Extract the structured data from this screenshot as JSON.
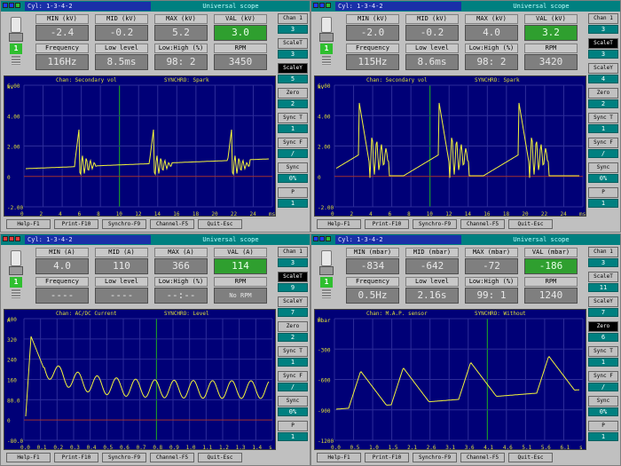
{
  "panels": [
    {
      "lamps": [
        "#1f3cff",
        "#1f3cff",
        "#2fbf2f"
      ],
      "cyl": "Cyl: 1-3-4-2",
      "name": "Universal scope",
      "plug": "1",
      "readings": [
        {
          "label": "MIN (kV)",
          "value": "-2.4",
          "green": false
        },
        {
          "label": "MID (kV)",
          "value": "-0.2",
          "green": false
        },
        {
          "label": "MAX (kV)",
          "value": "5.2",
          "green": false
        },
        {
          "label": "VAL (kV)",
          "value": "3.0",
          "green": true
        },
        {
          "label": "Frequency",
          "value": "116Hz",
          "green": false
        },
        {
          "label": "Low level",
          "value": "8.5ms",
          "green": false
        },
        {
          "label": "Low:High (%)",
          "value": "98: 2",
          "green": false
        },
        {
          "label": "RPM",
          "value": "3450",
          "green": false
        }
      ],
      "plot_left": "Chan: Secondary vol",
      "plot_right": "SYNCHRO: Spark",
      "unit": "kV",
      "y_ticks": [
        "6.00",
        "4.00",
        "2.00",
        "0",
        "-2.00"
      ],
      "x_ticks": [
        "0",
        "2",
        "4",
        "6",
        "8",
        "10",
        "12",
        "14",
        "16",
        "18",
        "20",
        "22",
        "24",
        "ms"
      ],
      "side": [
        {
          "btn": "Chan 1",
          "dark": false,
          "val": "3"
        },
        {
          "btn": "ScaleT",
          "dark": false,
          "val": "3"
        },
        {
          "btn": "ScaleY",
          "dark": true,
          "val": "5"
        },
        {
          "btn": "Zero",
          "dark": false,
          "val": "2"
        },
        {
          "btn": "Sync T",
          "dark": false,
          "val": "1"
        },
        {
          "btn": "Sync F",
          "dark": false,
          "val": "/"
        },
        {
          "btn": "Sync",
          "dark": false,
          "val": "0%"
        },
        {
          "btn": "P",
          "dark": false,
          "val": "1"
        }
      ],
      "fkeys": [
        "Help-F1",
        "Print-F10",
        "Synchro-F9",
        "Channel-F5",
        "Quit-Esc"
      ]
    },
    {
      "lamps": [
        "#1f3cff",
        "#1f3cff",
        "#2fbf2f"
      ],
      "cyl": "Cyl: 1-3-4-2",
      "name": "Universal scope",
      "plug": "1",
      "readings": [
        {
          "label": "MIN (kV)",
          "value": "-2.0",
          "green": false
        },
        {
          "label": "MID (kV)",
          "value": "-0.2",
          "green": false
        },
        {
          "label": "MAX (kV)",
          "value": "4.0",
          "green": false
        },
        {
          "label": "VAL (kV)",
          "value": "3.2",
          "green": true
        },
        {
          "label": "Frequency",
          "value": "115Hz",
          "green": false
        },
        {
          "label": "Low level",
          "value": "8.6ms",
          "green": false
        },
        {
          "label": "Low:High (%)",
          "value": "98: 2",
          "green": false
        },
        {
          "label": "RPM",
          "value": "3420",
          "green": false
        }
      ],
      "plot_left": "Chan: Secondary vol",
      "plot_right": "SYNCHRO: Spark",
      "unit": "kV",
      "y_ticks": [
        "6.00",
        "4.00",
        "2.00",
        "0",
        "-2.00"
      ],
      "x_ticks": [
        "0",
        "2",
        "4",
        "6",
        "8",
        "10",
        "12",
        "14",
        "16",
        "18",
        "20",
        "22",
        "24",
        "ms"
      ],
      "side": [
        {
          "btn": "Chan 1",
          "dark": false,
          "val": "3"
        },
        {
          "btn": "ScaleT",
          "dark": true,
          "val": "3"
        },
        {
          "btn": "ScaleY",
          "dark": false,
          "val": "4"
        },
        {
          "btn": "Zero",
          "dark": false,
          "val": "2"
        },
        {
          "btn": "Sync T",
          "dark": false,
          "val": "1"
        },
        {
          "btn": "Sync F",
          "dark": false,
          "val": "/"
        },
        {
          "btn": "Sync",
          "dark": false,
          "val": "0%"
        },
        {
          "btn": "P",
          "dark": false,
          "val": "1"
        }
      ],
      "fkeys": [
        "Help-F1",
        "Print-F10",
        "Synchro-F9",
        "Channel-F5",
        "Quit-Esc"
      ]
    },
    {
      "lamps": [
        "#e23b3b",
        "#e23b3b",
        "#e23b3b"
      ],
      "cyl": "Cyl: 1-3-4-2",
      "name": "Universal scope",
      "plug": "1",
      "readings": [
        {
          "label": "MIN (A)",
          "value": "4.0",
          "green": false
        },
        {
          "label": "MID (A)",
          "value": "110",
          "green": false
        },
        {
          "label": "MAX (A)",
          "value": "366",
          "green": false
        },
        {
          "label": "VAL (A)",
          "value": "114",
          "green": true
        },
        {
          "label": "Frequency",
          "value": "----",
          "green": false
        },
        {
          "label": "Low level",
          "value": "----",
          "green": false
        },
        {
          "label": "Low:High (%)",
          "value": "--:--",
          "green": false
        },
        {
          "label": "RPM",
          "value": "No RPM",
          "green": false
        }
      ],
      "plot_left": "Chan: AC/DC Current",
      "plot_right": "SYNCHRO: Level",
      "unit": "A",
      "y_ticks": [
        "400",
        "320",
        "240",
        "160",
        "80.0",
        "0",
        "-80.0"
      ],
      "x_ticks": [
        "0.0",
        "0.1",
        "0.2",
        "0.3",
        "0.4",
        "0.5",
        "0.6",
        "0.7",
        "0.8",
        "0.9",
        "1.0",
        "1.1",
        "1.2",
        "1.3",
        "1.4",
        "s"
      ],
      "side": [
        {
          "btn": "Chan 1",
          "dark": false,
          "val": "3"
        },
        {
          "btn": "ScaleT",
          "dark": true,
          "val": "9"
        },
        {
          "btn": "ScaleY",
          "dark": false,
          "val": "7"
        },
        {
          "btn": "Zero",
          "dark": false,
          "val": "2"
        },
        {
          "btn": "Sync T",
          "dark": false,
          "val": "1"
        },
        {
          "btn": "Sync F",
          "dark": false,
          "val": "/"
        },
        {
          "btn": "Sync",
          "dark": false,
          "val": "0%"
        },
        {
          "btn": "P",
          "dark": false,
          "val": "1"
        }
      ],
      "fkeys": [
        "Help-F1",
        "Print-F10",
        "Synchro-F9",
        "Channel-F5",
        "Quit-Esc"
      ]
    },
    {
      "lamps": [
        "#1f3cff",
        "#1f3cff",
        "#2fbf2f"
      ],
      "cyl": "Cyl: 1-3-4-2",
      "name": "Universal scope",
      "plug": "1",
      "readings": [
        {
          "label": "MIN (mbar)",
          "value": "-834",
          "green": false
        },
        {
          "label": "MID (mbar)",
          "value": "-642",
          "green": false
        },
        {
          "label": "MAX (mbar)",
          "value": "-72",
          "green": false
        },
        {
          "label": "VAL (mbar)",
          "value": "-186",
          "green": true
        },
        {
          "label": "Frequency",
          "value": "0.5Hz",
          "green": false
        },
        {
          "label": "Low level",
          "value": "2.16s",
          "green": false
        },
        {
          "label": "Low:High (%)",
          "value": "99: 1",
          "green": false
        },
        {
          "label": "RPM",
          "value": "1240",
          "green": false
        }
      ],
      "plot_left": "Chan: M.A.P. sensor",
      "plot_right": "SYNCHRO: Without",
      "unit": "mbar",
      "y_ticks": [
        "0",
        "-300",
        "-600",
        "-900",
        "-1200"
      ],
      "x_ticks": [
        "0.0",
        "0.5",
        "1.0",
        "1.5",
        "2.1",
        "2.6",
        "3.1",
        "3.6",
        "4.1",
        "4.6",
        "5.1",
        "5.6",
        "6.1",
        "s"
      ],
      "side": [
        {
          "btn": "Chan 1",
          "dark": false,
          "val": "3"
        },
        {
          "btn": "ScaleT",
          "dark": false,
          "val": "11"
        },
        {
          "btn": "ScaleY",
          "dark": false,
          "val": "7"
        },
        {
          "btn": "Zero",
          "dark": true,
          "val": "6"
        },
        {
          "btn": "Sync T",
          "dark": false,
          "val": "1"
        },
        {
          "btn": "Sync F",
          "dark": false,
          "val": "/"
        },
        {
          "btn": "Sync",
          "dark": false,
          "val": "0%"
        },
        {
          "btn": "P",
          "dark": false,
          "val": "1"
        }
      ],
      "fkeys": [
        "Help-F1",
        "Print-F10",
        "Synchro-F9",
        "Channel-F5",
        "Quit-Esc"
      ]
    }
  ]
}
